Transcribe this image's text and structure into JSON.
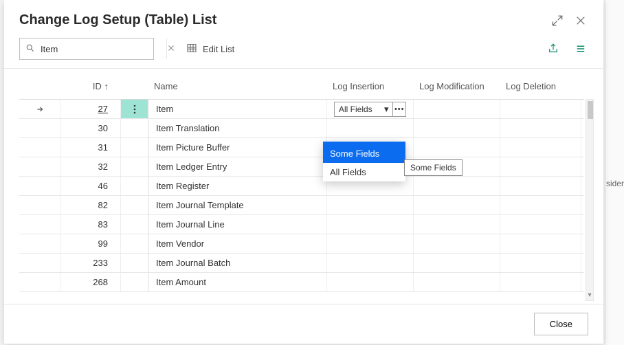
{
  "header": {
    "title": "Change Log Setup (Table) List"
  },
  "search": {
    "value": "Item"
  },
  "toolbar": {
    "edit_list": "Edit List"
  },
  "columns": {
    "id": "ID ↑",
    "name": "Name",
    "log_insertion": "Log Insertion",
    "log_modification": "Log Modification",
    "log_deletion": "Log Deletion"
  },
  "rows": [
    {
      "id": "27",
      "name": "Item",
      "logins": "All Fields",
      "selected": true
    },
    {
      "id": "30",
      "name": "Item Translation"
    },
    {
      "id": "31",
      "name": "Item Picture Buffer"
    },
    {
      "id": "32",
      "name": "Item Ledger Entry"
    },
    {
      "id": "46",
      "name": "Item Register"
    },
    {
      "id": "82",
      "name": "Item Journal Template"
    },
    {
      "id": "83",
      "name": "Item Journal Line"
    },
    {
      "id": "99",
      "name": "Item Vendor"
    },
    {
      "id": "233",
      "name": "Item Journal Batch"
    },
    {
      "id": "268",
      "name": "Item Amount"
    }
  ],
  "dropdown": {
    "items": [
      "Some Fields",
      "All Fields"
    ],
    "highlighted": 0
  },
  "tooltip": "Some Fields",
  "footer": {
    "close": "Close"
  },
  "background_cut_text": "sider"
}
